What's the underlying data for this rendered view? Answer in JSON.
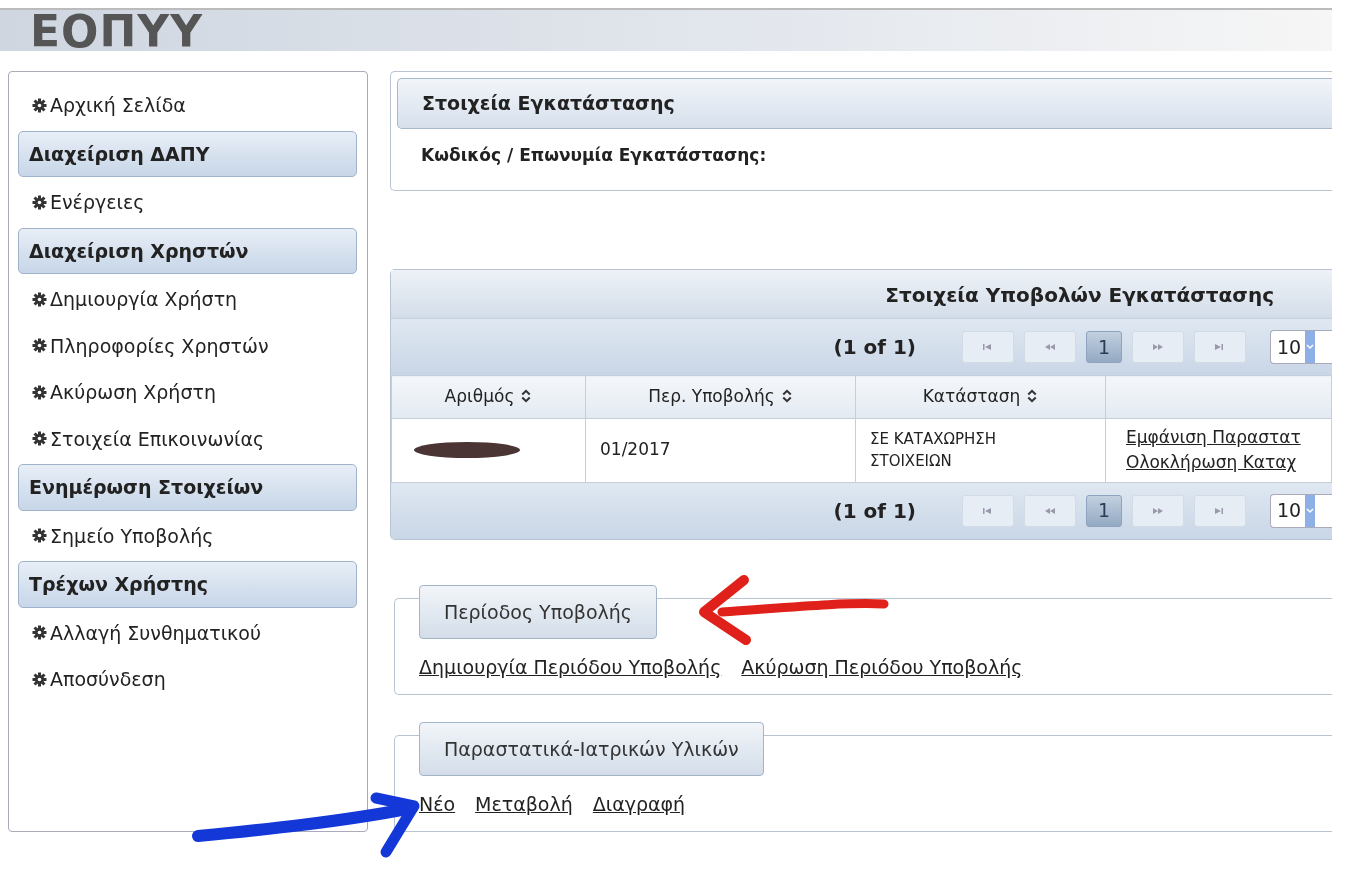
{
  "header": {
    "logo": "ΕΟΠΥΥ"
  },
  "sidebar": {
    "items": [
      {
        "kind": "link",
        "label": "Αρχική Σελίδα"
      },
      {
        "kind": "header",
        "label": "Διαχείριση ΔΑΠΥ"
      },
      {
        "kind": "link",
        "label": "Ενέργειες"
      },
      {
        "kind": "header",
        "label": "Διαχείριση Χρηστών"
      },
      {
        "kind": "link",
        "label": "Δημιουργία Χρήστη"
      },
      {
        "kind": "link",
        "label": "Πληροφορίες Χρηστών"
      },
      {
        "kind": "link",
        "label": "Ακύρωση Χρήστη"
      },
      {
        "kind": "link",
        "label": "Στοιχεία Επικοινωνίας"
      },
      {
        "kind": "header",
        "label": "Ενημέρωση Στοιχείων"
      },
      {
        "kind": "link",
        "label": "Σημείο Υποβολής"
      },
      {
        "kind": "header",
        "label": "Τρέχων Χρήστης"
      },
      {
        "kind": "link",
        "label": "Αλλαγή Συνθηματικού"
      },
      {
        "kind": "link",
        "label": "Αποσύνδεση"
      }
    ]
  },
  "facility": {
    "title": "Στοιχεία Εγκατάστασης",
    "label": "Κωδικός / Επωνυμία Εγκατάστασης:"
  },
  "submissions": {
    "title": "Στοιχεία Υποβολών Εγκατάστασης",
    "paginators": [
      {
        "summary": "(1 of 1)",
        "pages": [
          {
            "label": "1",
            "selected": true
          }
        ],
        "page_size": "10"
      },
      {
        "summary": "(1 of 1)",
        "pages": [
          {
            "label": "1",
            "selected": true
          }
        ],
        "page_size": "10"
      }
    ],
    "columns": [
      {
        "label": "Αριθμός",
        "sortable": true
      },
      {
        "label": "Περ. Υποβολής",
        "sortable": true
      },
      {
        "label": "Κατάσταση",
        "sortable": true
      },
      {
        "sortable": false
      }
    ],
    "rows": [
      {
        "number_redacted": true,
        "period": "01/2017",
        "status": "ΣΕ ΚΑΤΑΧΩΡΗΣΗ ΣΤΟΙΧΕΙΩΝ",
        "actions": [
          "Εμφάνιση Παραστατ",
          "Ολοκλήρωση Καταχ"
        ]
      }
    ]
  },
  "fieldsets": [
    {
      "legend": "Περίοδος Υποβολής",
      "links": [
        "Δημιουργία Περιόδου Υποβολής",
        "Ακύρωση Περιόδου Υποβολής"
      ]
    },
    {
      "legend": "Παραστατικά-Ιατρικών Υλικών",
      "links": [
        "Νέο",
        "Μεταβολή",
        "Διαγραφή"
      ]
    }
  ],
  "annotations": [
    {
      "kind": "arrow_left",
      "color": "#e0201a"
    },
    {
      "kind": "arrow_up_right",
      "color": "#1438d8"
    }
  ]
}
